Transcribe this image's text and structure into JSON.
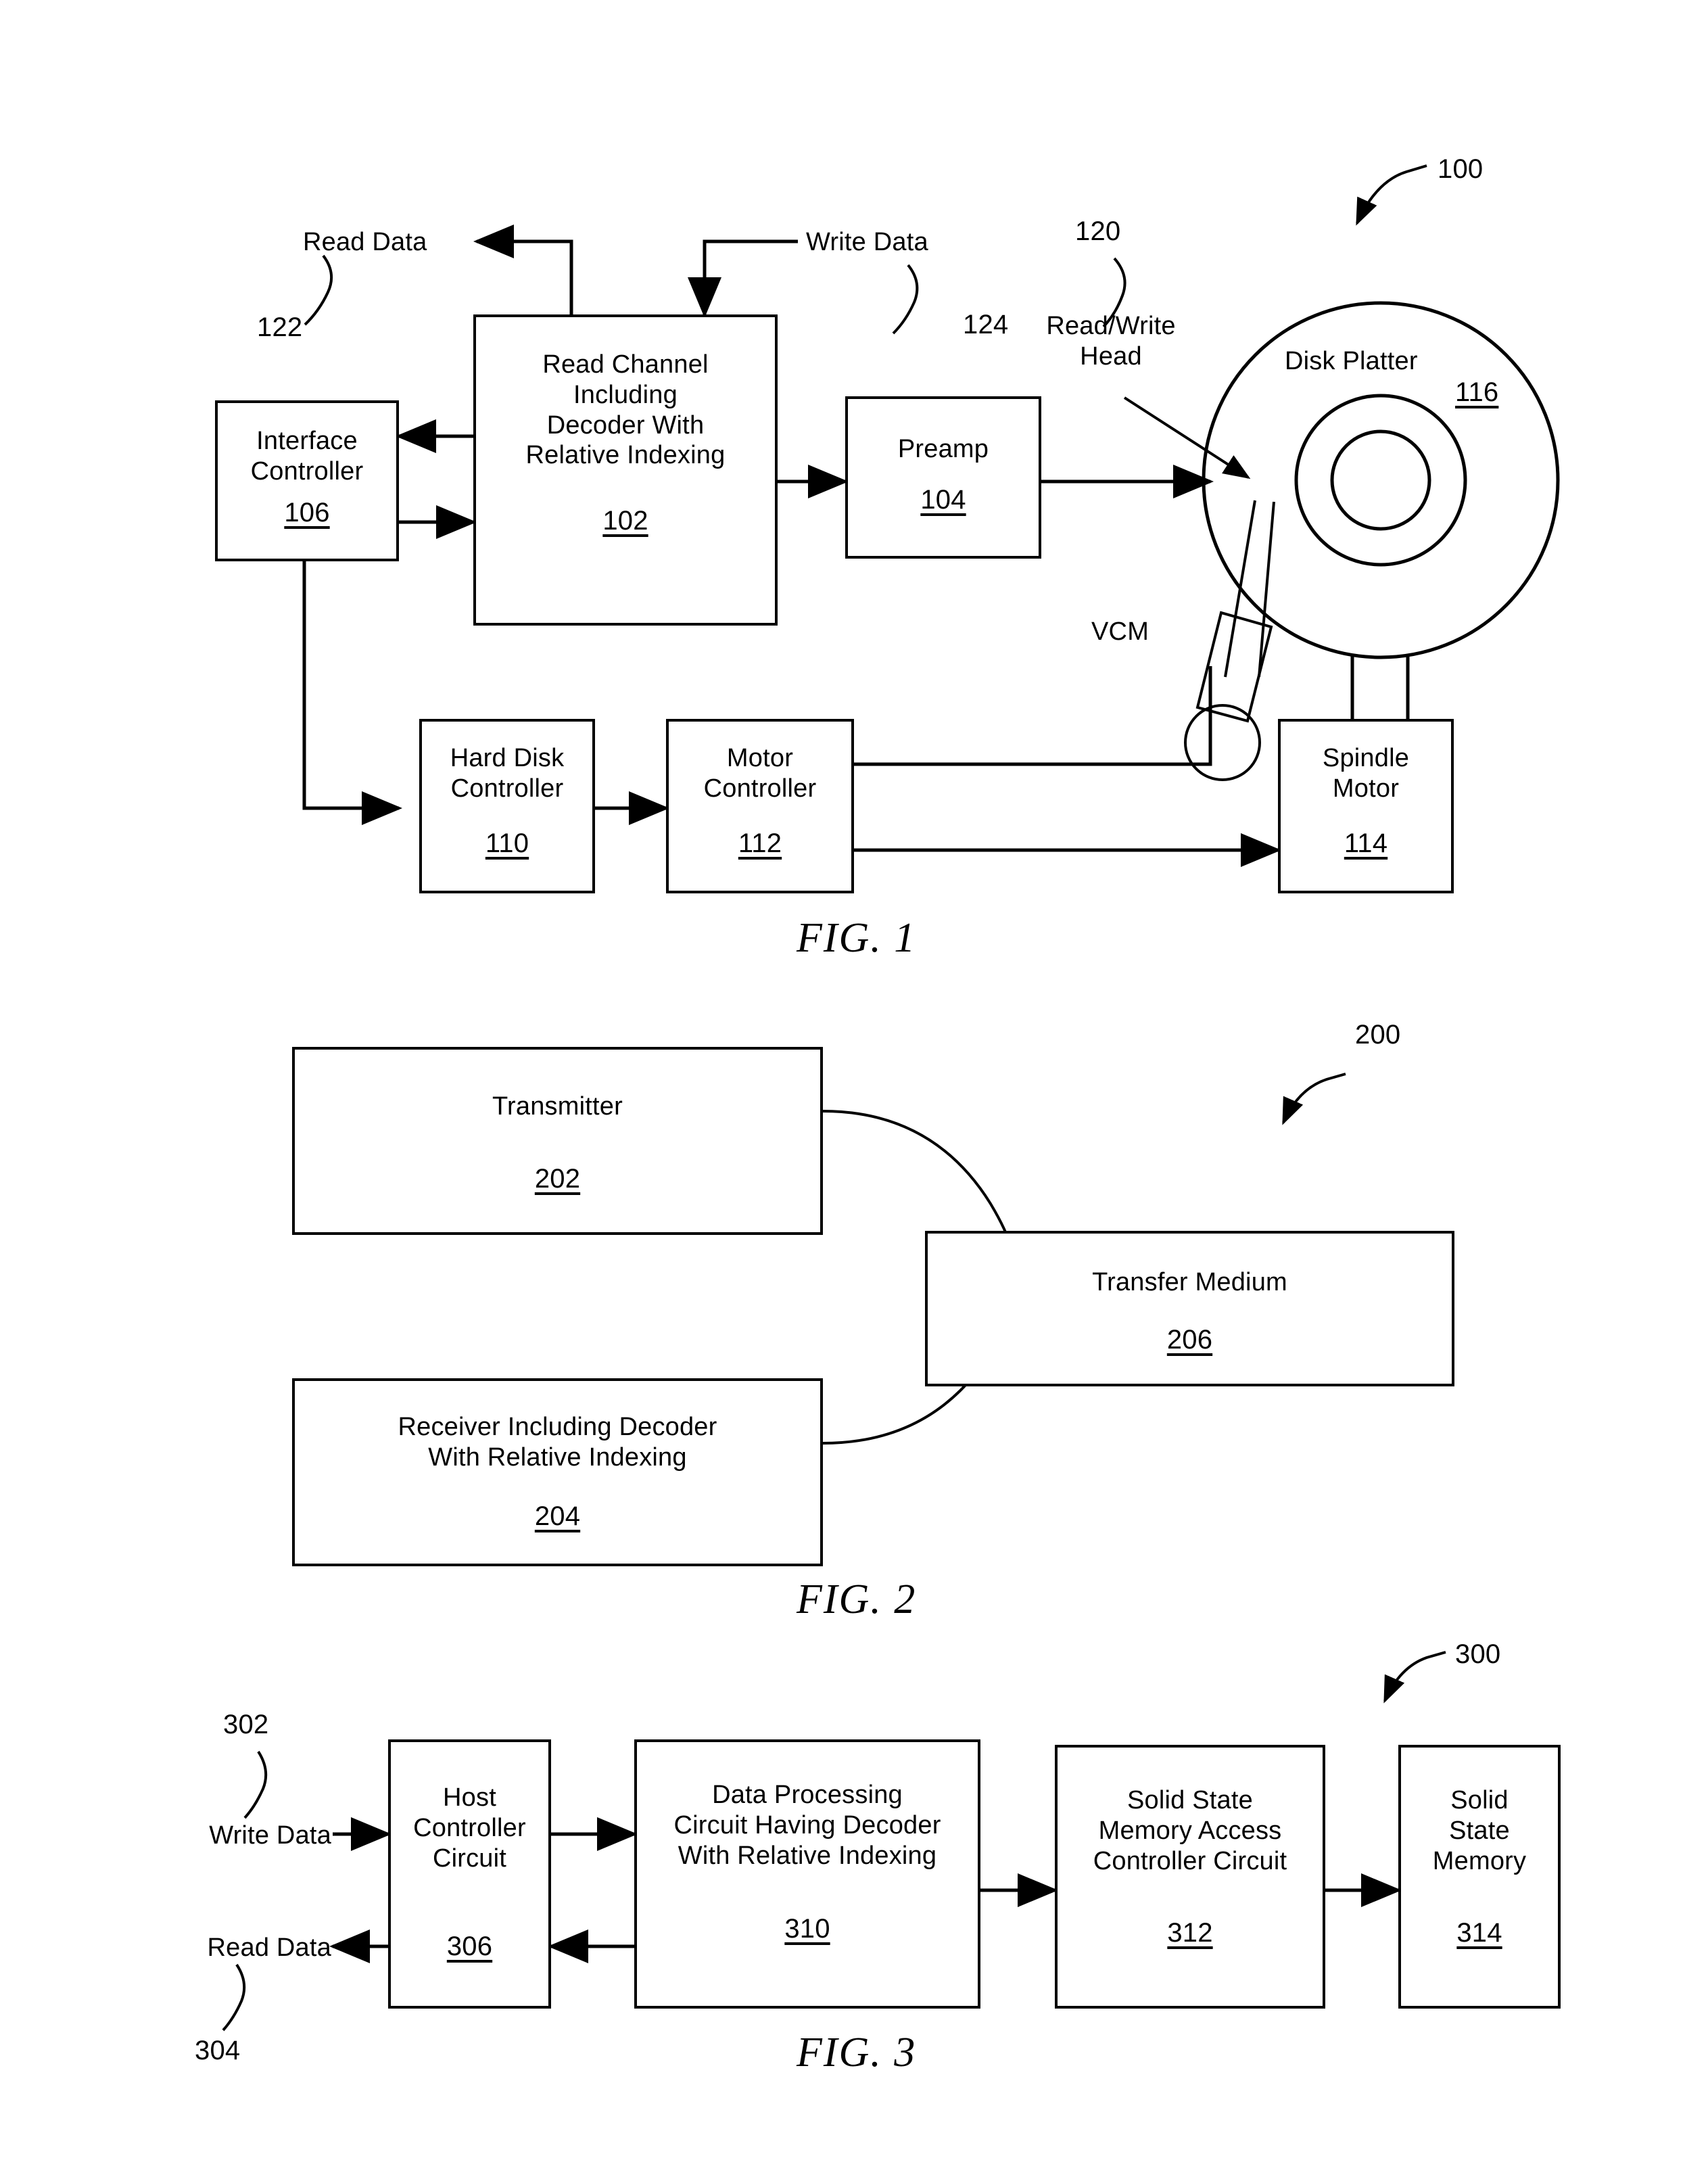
{
  "document": {
    "kind": "patent-drawing-sheet",
    "figures": [
      "FIG. 1",
      "FIG. 2",
      "FIG. 3"
    ]
  },
  "fig1": {
    "caption": "FIG. 1",
    "system_ref": "100",
    "signals": {
      "read_data_label": "Read Data",
      "read_data_ref": "122",
      "write_data_label": "Write Data",
      "write_data_ref": "124"
    },
    "head": {
      "label": "Read/Write\nHead",
      "ref": "120"
    },
    "vcm_label": "VCM",
    "platter": {
      "label": "Disk Platter",
      "ref": "116"
    },
    "blocks": [
      {
        "title": "Interface\nController",
        "ref": "106"
      },
      {
        "title": "Read Channel\nIncluding\nDecoder With\nRelative Indexing",
        "ref": "102"
      },
      {
        "title": "Preamp",
        "ref": "104"
      },
      {
        "title": "Hard Disk\nController",
        "ref": "110"
      },
      {
        "title": "Motor\nController",
        "ref": "112"
      },
      {
        "title": "Spindle\nMotor",
        "ref": "114"
      }
    ]
  },
  "fig2": {
    "caption": "FIG. 2",
    "system_ref": "200",
    "blocks": [
      {
        "title": "Transmitter",
        "ref": "202"
      },
      {
        "title": "Transfer Medium",
        "ref": "206"
      },
      {
        "title": "Receiver Including Decoder\nWith Relative Indexing",
        "ref": "204"
      }
    ]
  },
  "fig3": {
    "caption": "FIG. 3",
    "system_ref": "300",
    "signals": {
      "write_data_label": "Write Data",
      "write_data_ref": "302",
      "read_data_label": "Read Data",
      "read_data_ref": "304"
    },
    "blocks": [
      {
        "title": "Host\nController\nCircuit",
        "ref": "306"
      },
      {
        "title": "Data Processing\nCircuit Having Decoder\nWith Relative Indexing",
        "ref": "310"
      },
      {
        "title": "Solid State\nMemory Access\nController Circuit",
        "ref": "312"
      },
      {
        "title": "Solid\nState\nMemory",
        "ref": "314"
      }
    ]
  }
}
